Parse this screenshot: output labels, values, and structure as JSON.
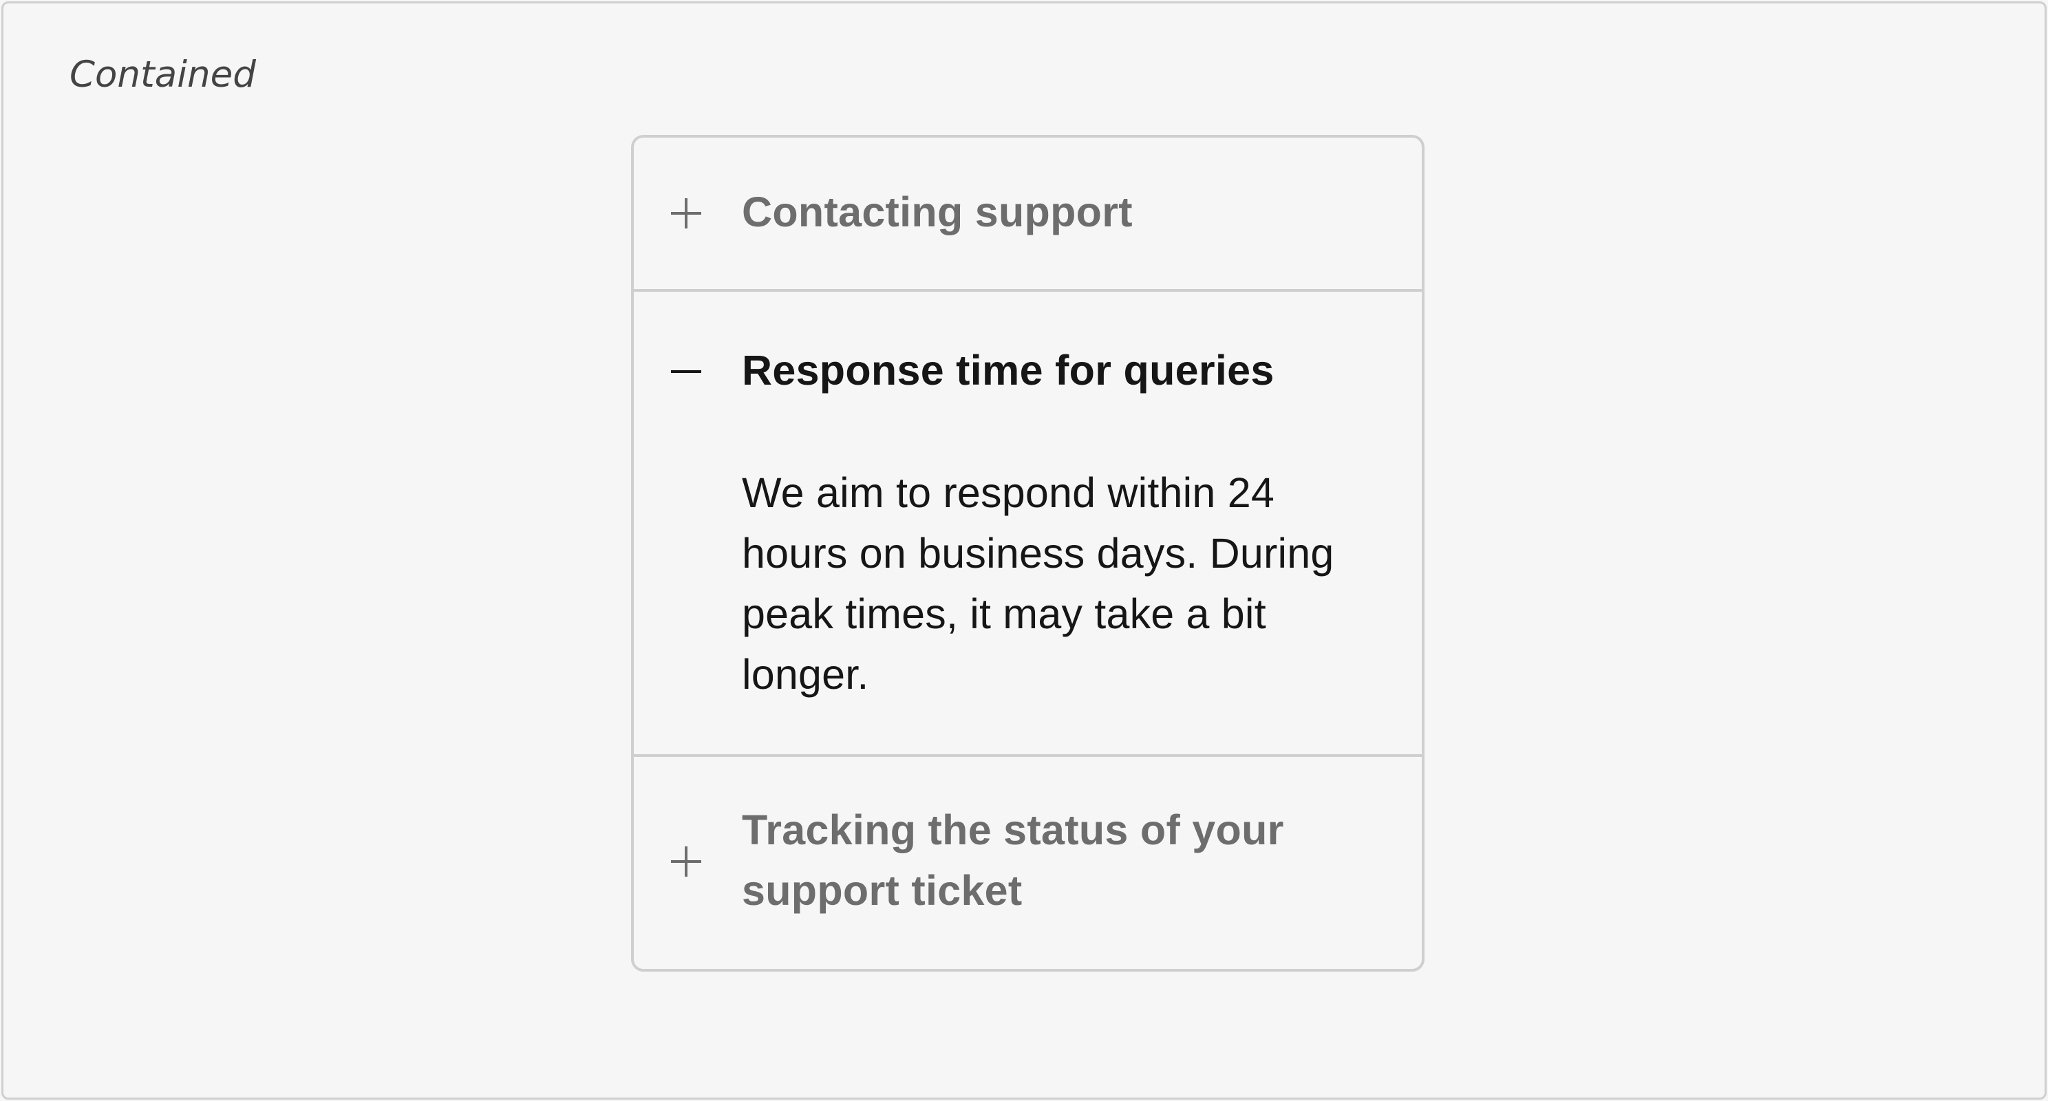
{
  "variant_label": "Contained",
  "accordion": {
    "items": [
      {
        "title": "Contacting support",
        "expanded": false,
        "icon": "plus-icon"
      },
      {
        "title": "Response time for queries",
        "expanded": true,
        "icon": "minus-icon",
        "body": "We aim to respond within 24 hours on business days. During peak times, it may take a bit longer."
      },
      {
        "title": "Tracking the status of your support ticket",
        "expanded": false,
        "icon": "plus-icon"
      }
    ]
  },
  "colors": {
    "background": "#f6f6f6",
    "border": "#cfcfcf",
    "collapsed_title": "#6d6d6d",
    "expanded_title": "#161616",
    "body_text": "#161616"
  }
}
